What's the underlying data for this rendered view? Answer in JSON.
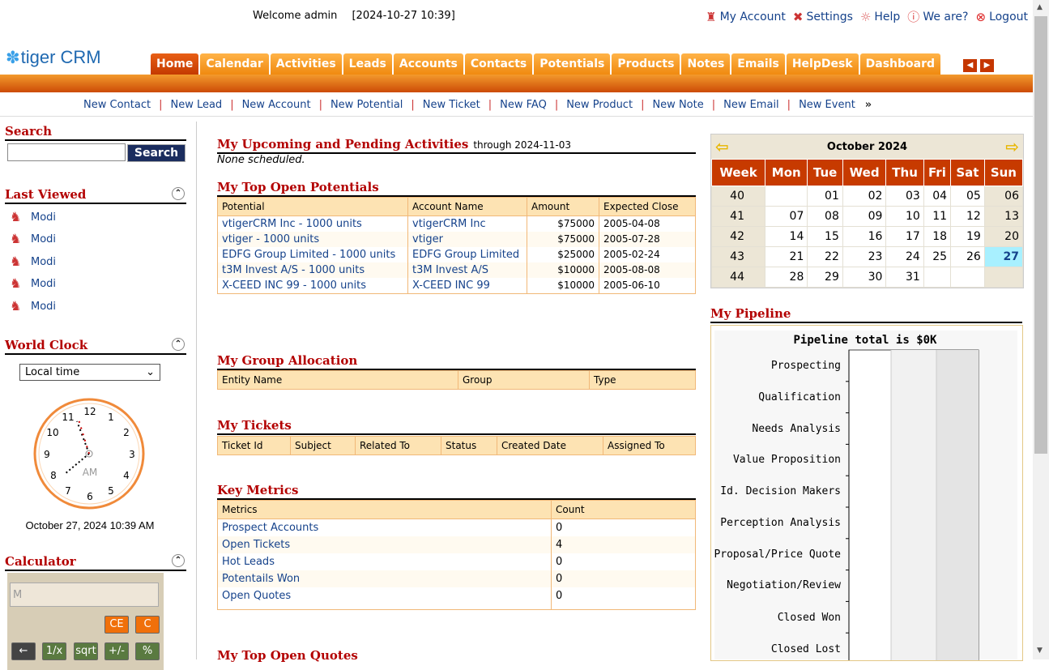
{
  "header": {
    "welcome": "Welcome admin",
    "timestamp": "[2024-10-27 10:39]",
    "links": [
      {
        "label": "My Account",
        "icon": "user-icon"
      },
      {
        "label": "Settings",
        "icon": "tools-icon"
      },
      {
        "label": "Help",
        "icon": "lightbulb-icon"
      },
      {
        "label": "We are?",
        "icon": "info-icon"
      },
      {
        "label": "Logout",
        "icon": "logout-icon"
      }
    ],
    "logo": "tiger CRM"
  },
  "tabs": [
    "Home",
    "Calendar",
    "Activities",
    "Leads",
    "Accounts",
    "Contacts",
    "Potentials",
    "Products",
    "Notes",
    "Emails",
    "HelpDesk",
    "Dashboard"
  ],
  "quicklinks": [
    "New Contact",
    "New Lead",
    "New Account",
    "New Potential",
    "New Ticket",
    "New FAQ",
    "New Product",
    "New Note",
    "New Email",
    "New Event"
  ],
  "quicklinks_more": "»",
  "left": {
    "search_title": "Search",
    "search_button": "Search",
    "search_value": "",
    "last_viewed_title": "Last Viewed",
    "last_viewed": [
      "Modi",
      "Modi",
      "Modi",
      "Modi",
      "Modi"
    ],
    "world_clock_title": "World Clock",
    "timezone": "Local time",
    "clock_numbers": [
      "12",
      "1",
      "2",
      "3",
      "4",
      "5",
      "6",
      "7",
      "8",
      "9",
      "10",
      "11"
    ],
    "clock_ampm": "AM",
    "clock_date": "October 27, 2024 10:39 AM",
    "calculator_title": "Calculator",
    "calc_display": "M",
    "calc_buttons": {
      "ce": "CE",
      "c": "C",
      "back": "←",
      "inv": "1/x",
      "sqrt": "sqrt",
      "neg": "+/-",
      "pct": "%"
    }
  },
  "center": {
    "upcoming_title": "My Upcoming and Pending Activities",
    "upcoming_through": "through 2024-11-03",
    "upcoming_none": "None scheduled.",
    "potentials_title": "My Top Open Potentials",
    "potentials_headers": [
      "Potential",
      "Account Name",
      "Amount",
      "Expected Close"
    ],
    "potentials_rows": [
      [
        "vtigerCRM Inc - 1000 units",
        "vtigerCRM Inc",
        "$75000",
        "2005-04-08"
      ],
      [
        "vtiger - 1000 units",
        "vtiger",
        "$75000",
        "2005-07-28"
      ],
      [
        "EDFG Group Limited - 1000 units",
        "EDFG Group Limited",
        "$25000",
        "2005-02-24"
      ],
      [
        "t3M Invest A/S - 1000 units",
        "t3M Invest A/S",
        "$10000",
        "2005-08-08"
      ],
      [
        "X-CEED INC 99 - 1000 units",
        "X-CEED INC 99",
        "$10000",
        "2005-06-10"
      ]
    ],
    "group_title": "My Group Allocation",
    "group_headers": [
      "Entity Name",
      "Group",
      "Type"
    ],
    "tickets_title": "My Tickets",
    "tickets_headers": [
      "Ticket Id",
      "Subject",
      "Related To",
      "Status",
      "Created Date",
      "Assigned To"
    ],
    "metrics_title": "Key Metrics",
    "metrics_headers": [
      "Metrics",
      "Count"
    ],
    "metrics_rows": [
      [
        "Prospect Accounts",
        "0"
      ],
      [
        "Open Tickets",
        "4"
      ],
      [
        "Hot Leads",
        "0"
      ],
      [
        "Potentails Won",
        "0"
      ],
      [
        "Open Quotes",
        "0"
      ]
    ],
    "quotes_title": "My Top Open Quotes"
  },
  "calendar": {
    "month": "October 2024",
    "headers": [
      "Week",
      "Mon",
      "Tue",
      "Wed",
      "Thu",
      "Fri",
      "Sat",
      "Sun"
    ],
    "rows": [
      [
        "40",
        "",
        "01",
        "02",
        "03",
        "04",
        "05",
        "06"
      ],
      [
        "41",
        "07",
        "08",
        "09",
        "10",
        "11",
        "12",
        "13"
      ],
      [
        "42",
        "14",
        "15",
        "16",
        "17",
        "18",
        "19",
        "20"
      ],
      [
        "43",
        "21",
        "22",
        "23",
        "24",
        "25",
        "26",
        "27"
      ],
      [
        "44",
        "28",
        "29",
        "30",
        "31",
        "",
        "",
        ""
      ]
    ],
    "today": "27"
  },
  "pipeline": {
    "title": "My Pipeline",
    "chart_title": "Pipeline total is $0K",
    "stages": [
      "Prospecting",
      "Qualification",
      "Needs Analysis",
      "Value Proposition",
      "Id. Decision Makers",
      "Perception Analysis",
      "Proposal/Price Quote",
      "Negotiation/Review",
      "Closed Won",
      "Closed Lost"
    ]
  },
  "chart_data": {
    "type": "bar",
    "title": "Pipeline total is $0K",
    "categories": [
      "Prospecting",
      "Qualification",
      "Needs Analysis",
      "Value Proposition",
      "Id. Decision Makers",
      "Perception Analysis",
      "Proposal/Price Quote",
      "Negotiation/Review",
      "Closed Won",
      "Closed Lost"
    ],
    "values": [
      0,
      0,
      0,
      0,
      0,
      0,
      0,
      0,
      0,
      0
    ],
    "orientation": "horizontal"
  }
}
